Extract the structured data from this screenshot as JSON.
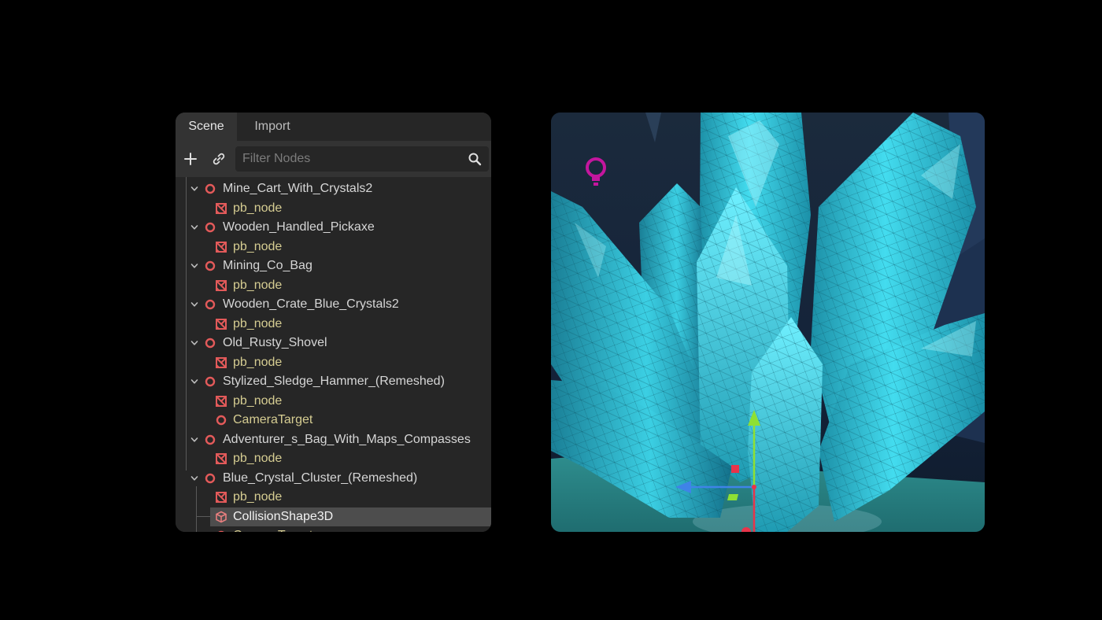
{
  "tabs": [
    {
      "label": "Scene",
      "active": true
    },
    {
      "label": "Import",
      "active": false
    }
  ],
  "toolbar": {
    "add_icon": "plus-icon",
    "link_icon": "link-icon"
  },
  "filter": {
    "placeholder": "Filter Nodes",
    "value": ""
  },
  "tree": [
    {
      "label": "Mine_Cart_With_Crystals2",
      "level": 0,
      "icon": "node3d-icon",
      "expanded": true
    },
    {
      "label": "pb_node",
      "level": 1,
      "icon": "mesh-instance-icon"
    },
    {
      "label": "Wooden_Handled_Pickaxe",
      "level": 0,
      "icon": "node3d-icon",
      "expanded": true
    },
    {
      "label": "pb_node",
      "level": 1,
      "icon": "mesh-instance-icon"
    },
    {
      "label": "Mining_Co_Bag",
      "level": 0,
      "icon": "node3d-icon",
      "expanded": true
    },
    {
      "label": "pb_node",
      "level": 1,
      "icon": "mesh-instance-icon"
    },
    {
      "label": "Wooden_Crate_Blue_Crystals2",
      "level": 0,
      "icon": "node3d-icon",
      "expanded": true
    },
    {
      "label": "pb_node",
      "level": 1,
      "icon": "mesh-instance-icon"
    },
    {
      "label": "Old_Rusty_Shovel",
      "level": 0,
      "icon": "node3d-icon",
      "expanded": true
    },
    {
      "label": "pb_node",
      "level": 1,
      "icon": "mesh-instance-icon"
    },
    {
      "label": "Stylized_Sledge_Hammer_(Remeshed)",
      "level": 0,
      "icon": "node3d-icon",
      "expanded": true
    },
    {
      "label": "pb_node",
      "level": 1,
      "icon": "mesh-instance-icon"
    },
    {
      "label": "CameraTarget",
      "level": 1,
      "icon": "node3d-icon"
    },
    {
      "label": "Adventurer_s_Bag_With_Maps_Compasses",
      "level": 0,
      "icon": "node3d-icon",
      "expanded": true
    },
    {
      "label": "pb_node",
      "level": 1,
      "icon": "mesh-instance-icon"
    },
    {
      "label": "Blue_Crystal_Cluster_(Remeshed)",
      "level": 0,
      "icon": "node3d-icon",
      "expanded": true
    },
    {
      "label": "pb_node",
      "level": 1,
      "icon": "mesh-instance-icon"
    },
    {
      "label": "CollisionShape3D",
      "level": 1,
      "icon": "collision-shape-icon",
      "selected": true
    },
    {
      "label": "CameraTarget",
      "level": 1,
      "icon": "node3d-icon"
    }
  ],
  "colors": {
    "node_icon": "#e35a5a",
    "child_label": "#d6cd92",
    "selection": "#4d4d4d",
    "crystal": "#3fd6e8",
    "light_gizmo": "#c4169e",
    "gizmo_x": "#e8344a",
    "gizmo_y": "#8ee033",
    "gizmo_z": "#3f83e8"
  },
  "viewport": {
    "light_gizmo": "light-bulb-icon",
    "transform_gizmo": "move-gizmo-icon"
  }
}
